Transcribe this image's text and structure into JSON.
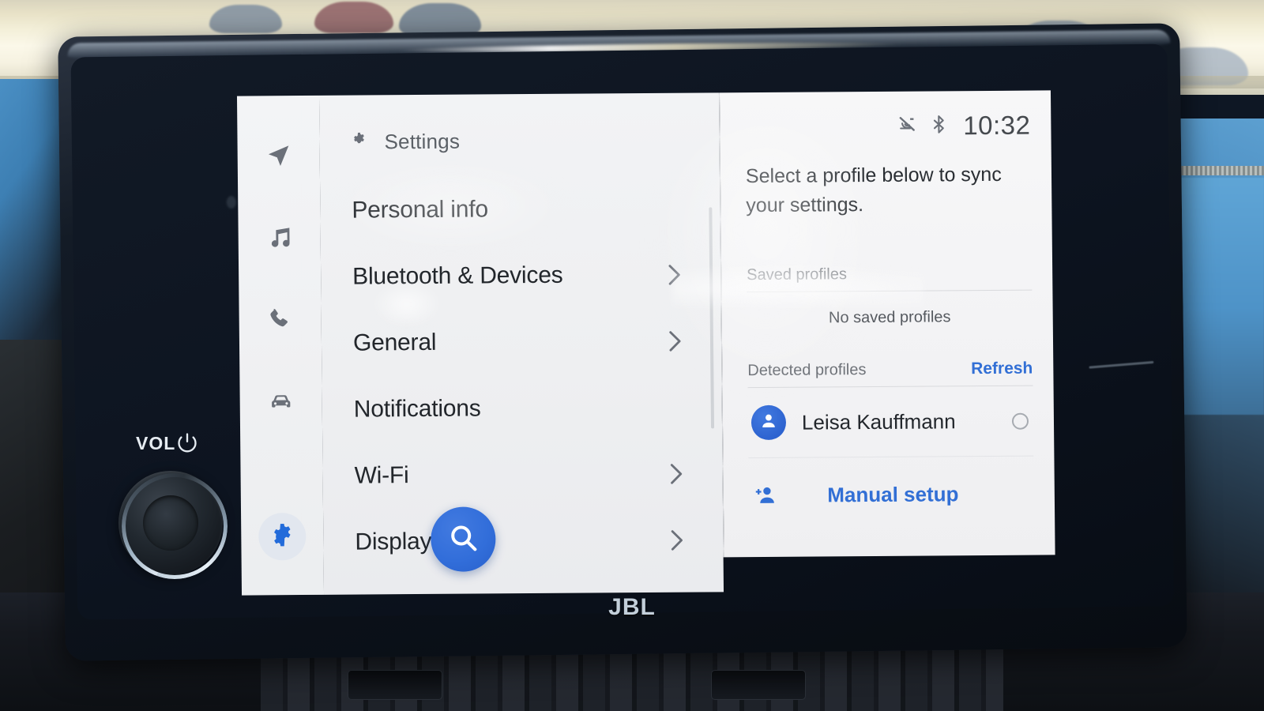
{
  "device": {
    "brand_logo": "JBL",
    "volume_label": "VOL",
    "power_icon": "power-icon",
    "knob": "volume-knob"
  },
  "rail": {
    "items": [
      {
        "icon": "navigation-icon",
        "name": "navigation",
        "active": false
      },
      {
        "icon": "music-note-icon",
        "name": "media",
        "active": false
      },
      {
        "icon": "phone-icon",
        "name": "phone",
        "active": false
      },
      {
        "icon": "car-icon",
        "name": "vehicle",
        "active": false
      },
      {
        "icon": "gear-icon",
        "name": "settings",
        "active": true
      }
    ]
  },
  "settings_list": {
    "header_icon": "gear-icon",
    "title": "Settings",
    "items": [
      {
        "label": "Personal info",
        "chevron": false
      },
      {
        "label": "Bluetooth & Devices",
        "chevron": true
      },
      {
        "label": "General",
        "chevron": true
      },
      {
        "label": "Notifications",
        "chevron": false
      },
      {
        "label": "Wi-Fi",
        "chevron": true
      },
      {
        "label": "Display",
        "chevron": true
      }
    ],
    "search_fab_icon": "search-icon"
  },
  "status_bar": {
    "icons": [
      "mic-muted-icon",
      "bluetooth-icon"
    ],
    "clock": "10:32"
  },
  "detail": {
    "prompt": "Select a profile below to sync your settings.",
    "saved": {
      "section_label": "Saved profiles",
      "empty_text": "No saved profiles"
    },
    "detected": {
      "section_label": "Detected profiles",
      "refresh_label": "Refresh",
      "profiles": [
        {
          "name": "Leisa Kauffmann",
          "avatar_icon": "person-icon",
          "selected": false
        }
      ]
    },
    "manual": {
      "icon": "person-add-icon",
      "label": "Manual setup"
    }
  },
  "colors": {
    "accent_blue": "#2f6fdb",
    "fab_blue": "#2f6ee0",
    "panel_bg": "#f2f3f5",
    "detail_bg": "#f7f7f8",
    "text_primary": "#23272c",
    "text_secondary": "#6e7278"
  }
}
